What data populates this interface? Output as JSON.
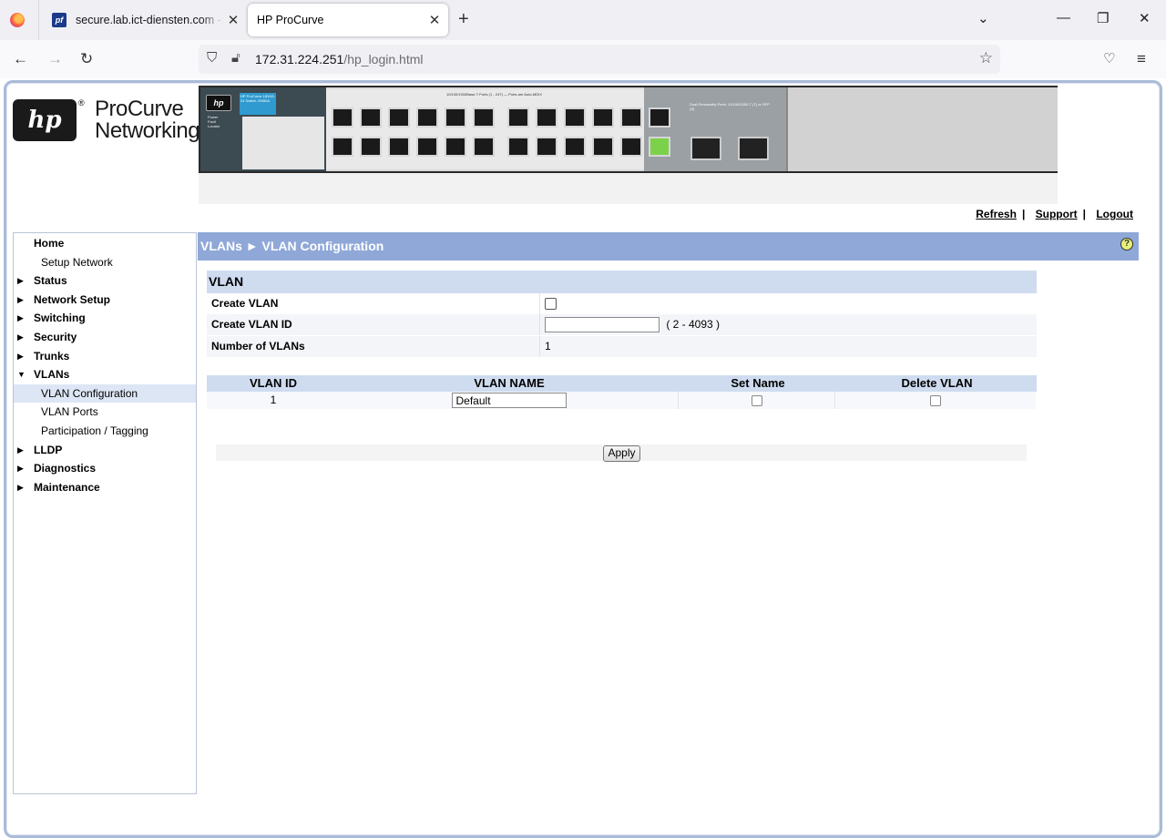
{
  "browser": {
    "tabs": [
      {
        "title": "secure.lab.ict-diensten.com - St",
        "favicon": "pfsense-icon",
        "favicon_text": "pf"
      },
      {
        "title": "HP ProCurve",
        "active": true
      }
    ],
    "url_host": "172.31.224.251",
    "url_path": "/hp_login.html"
  },
  "header": {
    "logo_text": "hp",
    "brand_line1": "ProCurve",
    "brand_line2": "Networking",
    "faceplate": {
      "model_badge": "HP ProCurve 1810G-24 Switch J9450A",
      "ports_caption": "10/100/1000Base-T Ports (1 - 24T) — Ports are Auto-MDIX",
      "dual_caption": "Dual-Personality Ports: 10/100/1000-T (T) or SFP (S)",
      "leds": [
        "Power",
        "Fault",
        "Locator"
      ],
      "active_port": 22
    }
  },
  "toplinks": {
    "refresh": "Refresh",
    "support": "Support",
    "logout": "Logout",
    "separator": "|"
  },
  "sidebar": {
    "items": [
      {
        "label": "Home",
        "level": "top",
        "arrow": ""
      },
      {
        "label": "Setup Network",
        "level": "sub"
      },
      {
        "label": "Status",
        "level": "top",
        "arrow": "▶"
      },
      {
        "label": "Network Setup",
        "level": "top",
        "arrow": "▶"
      },
      {
        "label": "Switching",
        "level": "top",
        "arrow": "▶"
      },
      {
        "label": "Security",
        "level": "top",
        "arrow": "▶"
      },
      {
        "label": "Trunks",
        "level": "top",
        "arrow": "▶"
      },
      {
        "label": "VLANs",
        "level": "top",
        "arrow": "▼"
      },
      {
        "label": "VLAN Configuration",
        "level": "sub",
        "active": true
      },
      {
        "label": "VLAN Ports",
        "level": "sub"
      },
      {
        "label": "Participation / Tagging",
        "level": "sub"
      },
      {
        "label": "LLDP",
        "level": "top",
        "arrow": "▶"
      },
      {
        "label": "Diagnostics",
        "level": "top",
        "arrow": "▶"
      },
      {
        "label": "Maintenance",
        "level": "top",
        "arrow": "▶"
      }
    ]
  },
  "content": {
    "breadcrumb": "VLANs ► VLAN Configuration",
    "help_glyph": "?",
    "vlan_section": {
      "title": "VLAN",
      "create_vlan_label": "Create VLAN",
      "create_vlan_checked": false,
      "create_vlan_id_label": "Create VLAN ID",
      "create_vlan_id_value": "",
      "create_vlan_id_range": "( 2 - 4093 )",
      "number_of_vlans_label": "Number of VLANs",
      "number_of_vlans_value": "1"
    },
    "vlan_table": {
      "headers": {
        "id": "VLAN ID",
        "name": "VLAN NAME",
        "set_name": "Set Name",
        "delete": "Delete VLAN"
      },
      "rows": [
        {
          "id": "1",
          "name": "Default",
          "set_name": false,
          "delete": false
        }
      ]
    },
    "apply_label": "Apply"
  },
  "colors": {
    "content_bar": "#8fa8d8",
    "section_header": "#cfdcf0",
    "frame_border": "#aabbd8",
    "sidebar_active": "#dde6f4"
  }
}
